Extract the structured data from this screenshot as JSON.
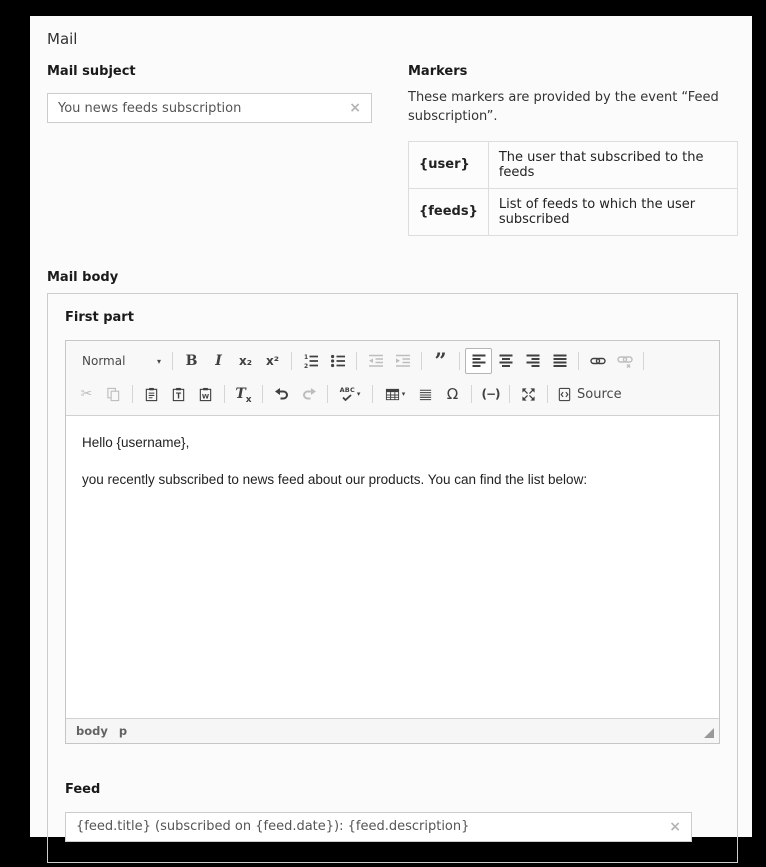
{
  "page": {
    "title": "Mail"
  },
  "mail_subject": {
    "label": "Mail subject",
    "value": "You news feeds subscription",
    "clear_icon": "×"
  },
  "markers": {
    "heading": "Markers",
    "description": "These markers are provided by the event “Feed subscription”.",
    "rows": [
      {
        "marker": "{user}",
        "description": "The user that subscribed to the feeds"
      },
      {
        "marker": "{feeds}",
        "description": "List of feeds to which the user subscribed"
      }
    ]
  },
  "mail_body_label": "Mail body",
  "first_part": {
    "legend": "First part"
  },
  "editor": {
    "format": "Normal",
    "caret": "▾",
    "source_label": "Source",
    "icons": {
      "bold": "B",
      "italic": "I",
      "subscript": "x₂",
      "superscript": "x²",
      "blockquote": "”",
      "cut": "✂",
      "removeformat_base": "T",
      "removeformat_sub": "x",
      "spellcheck": "ABC",
      "omega": "Ω",
      "dash": "(−)"
    },
    "content": {
      "line1": "Hello {username},",
      "line2": "you recently subscribed to news feed about our products. You can find the list below:"
    },
    "path": {
      "root": "body",
      "element": "p"
    }
  },
  "feed": {
    "legend": "Feed",
    "value": "{feed.title} (subscribed on {feed.date}): {feed.description}",
    "clear_icon": "×"
  }
}
